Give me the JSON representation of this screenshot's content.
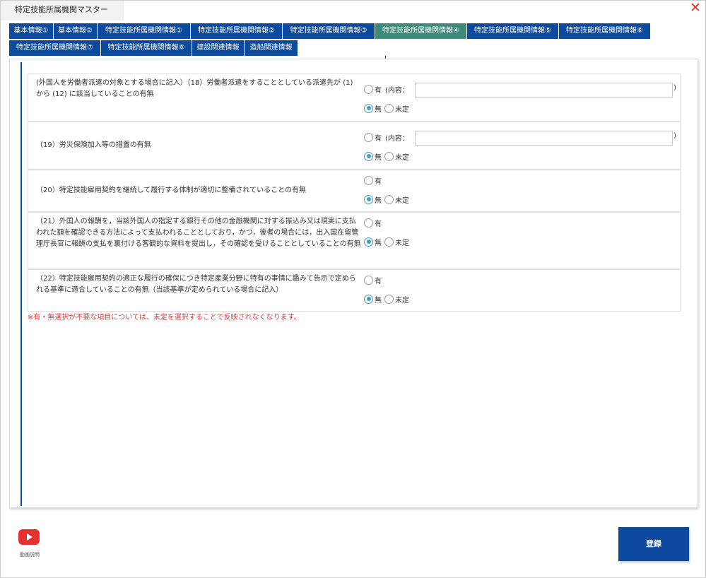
{
  "window": {
    "title": "特定技能所属機関マスター",
    "close_symbol": "✕"
  },
  "tabs": [
    {
      "label": "基本情報①",
      "active": false
    },
    {
      "label": "基本情報②",
      "active": false
    },
    {
      "label": "特定技能所属機関情報①",
      "active": false
    },
    {
      "label": "特定技能所属機関情報②",
      "active": false
    },
    {
      "label": "特定技能所属機関情報③",
      "active": false
    },
    {
      "label": "特定技能所属機関情報④",
      "active": true
    },
    {
      "label": "特定技能所属機関情報⑤",
      "active": false
    },
    {
      "label": "特定技能所属機関情報⑥",
      "active": false
    },
    {
      "label": "特定技能所属機関情報⑦",
      "active": false
    },
    {
      "label": "特定技能所属機関情報⑧",
      "active": false
    },
    {
      "label": "建設関連情報",
      "active": false
    },
    {
      "label": "造船関連情報",
      "active": false
    }
  ],
  "questions": [
    {
      "text": "(外国人を労働者派遣の対象とする場合に記入）（18）労働者派遣をすることとしている派遣先が (1) から (12) に該当していることの有無",
      "yes_label": "有",
      "detail_label": "(内容：",
      "detail_value": "",
      "detail_close": ")",
      "no_label": "無",
      "undecided_label": "未定",
      "selected": "no"
    },
    {
      "text": "（19）労災保険加入等の措置の有無",
      "yes_label": "有",
      "detail_label": "(内容：",
      "detail_value": "",
      "detail_close": ")",
      "no_label": "無",
      "undecided_label": "未定",
      "selected": "no"
    },
    {
      "text": "（20）特定技能雇用契約を継続して履行する体制が適切に整備されていることの有無",
      "yes_label": "有",
      "no_label": "無",
      "undecided_label": "未定",
      "selected": "no"
    },
    {
      "text": "（21）外国人の報酬を，当該外国人の指定する銀行その他の金融機関に対する振込み又は現実に支払われた額を確認できる方法によって支払われることとしており，かつ，後者の場合には，出入国在留管理庁長官に報酬の支払を裏付ける客観的な資料を提出し，その確認を受けることとしていることの有無",
      "yes_label": "有",
      "no_label": "無",
      "undecided_label": "未定",
      "selected": "no"
    },
    {
      "text": "（22）特定技能雇用契約の適正な履行の確保につき特定産業分野に特有の事情に鑑みて告示で定められる基準に適合していることの有無（当該基準が定められている場合に記入）",
      "yes_label": "有",
      "no_label": "無",
      "undecided_label": "未定",
      "selected": "no"
    }
  ],
  "note": "※有・無選択が不要な項目については、未定を選択することで反映されなくなります。",
  "footer": {
    "video_label": "動画説明",
    "register_label": "登録"
  },
  "colors": {
    "tab_bg": "#0c4a9e",
    "tab_active_bg": "#3b8a7a",
    "note": "#e23a3a",
    "close": "#e03030",
    "radio_checked": "#3aa0c6",
    "video_icon": "#e53030"
  }
}
